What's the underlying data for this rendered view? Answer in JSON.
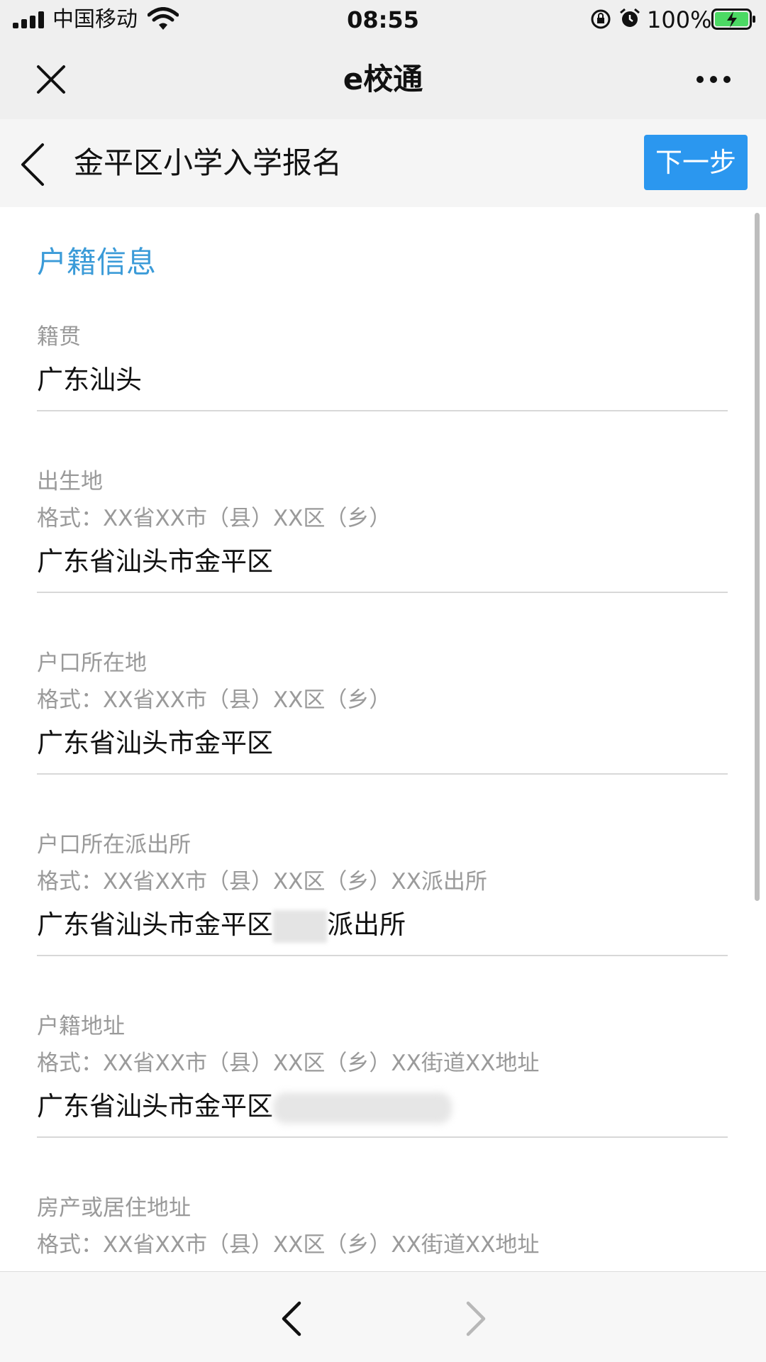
{
  "status_bar": {
    "carrier": "中国移动",
    "time": "08:55",
    "battery": "100%",
    "icons": [
      "signal-icon",
      "wifi-icon",
      "orientation-lock-icon",
      "alarm-icon",
      "battery-charging-icon"
    ]
  },
  "title_bar": {
    "title": "e校通",
    "icons": [
      "close-icon",
      "more-icon"
    ]
  },
  "header": {
    "title": "金平区小学入学报名",
    "next_label": "下一步",
    "icons": [
      "back-chevron-icon"
    ]
  },
  "form": {
    "section_title": "户籍信息",
    "fields": [
      {
        "label": "籍贯",
        "hint": "",
        "value": "广东汕头"
      },
      {
        "label": "出生地",
        "hint": "格式：XX省XX市（县）XX区（乡）",
        "value": "广东省汕头市金平区"
      },
      {
        "label": "户口所在地",
        "hint": "格式：XX省XX市（县）XX区（乡）",
        "value": "广东省汕头市金平区"
      },
      {
        "label": "户口所在派出所",
        "hint": "格式：XX省XX市（县）XX区（乡）XX派出所",
        "value": "广东省汕头市金平区",
        "value_suffix": "派出所"
      },
      {
        "label": "户籍地址",
        "hint": "格式：XX省XX市（县）XX区（乡）XX街道XX地址",
        "value": "广东省汕头市金平区"
      },
      {
        "label": "房产或居住地址",
        "hint": "格式：XX省XX市（县）XX区（乡）XX街道XX地址",
        "value": ""
      }
    ]
  },
  "bottom_nav": {
    "icons": [
      "nav-back-icon",
      "nav-forward-icon"
    ]
  },
  "colors": {
    "accent": "#2b97ef",
    "section_title": "#3b9bd8",
    "bar_background": "#efefef",
    "label_gray": "#9a9a9a"
  }
}
